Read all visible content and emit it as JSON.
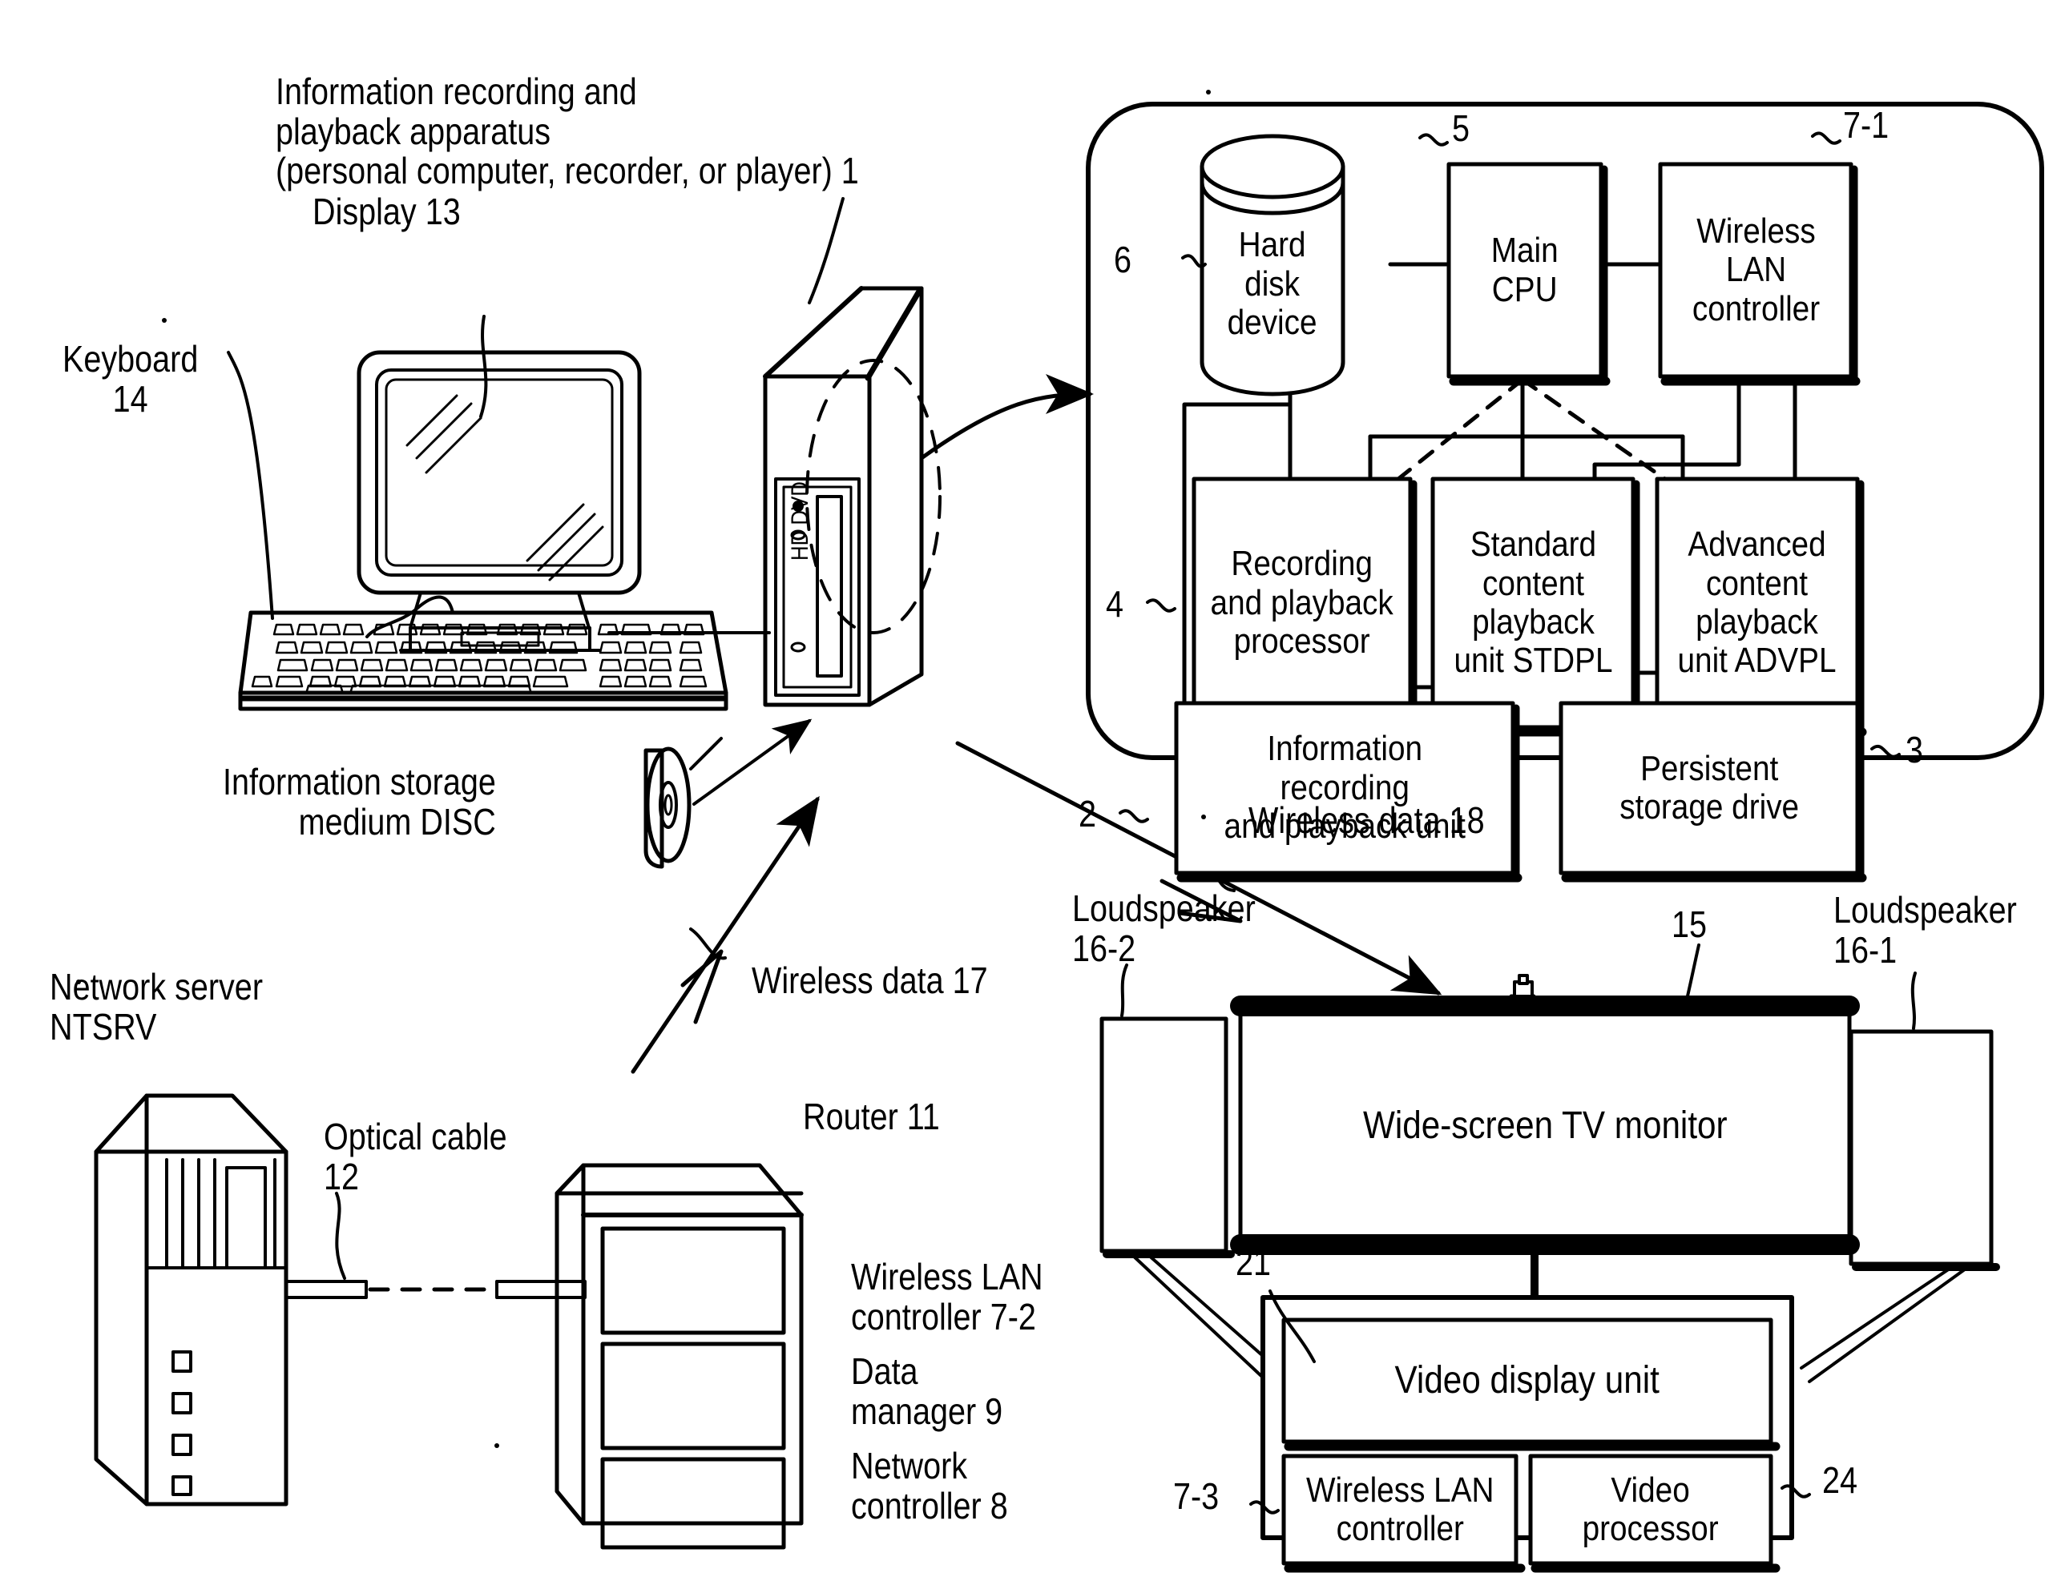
{
  "figure": {
    "title_label": "Information recording and\nplayback apparatus\n(personal computer, recorder, or player) 1",
    "display_label": "Display 13",
    "keyboard_label": "Keyboard\n14",
    "disc_label": "Information storage\nmedium DISC",
    "tower_drive_label": "HD DVD",
    "network_server_label": "Network server\nNTSRV",
    "optical_cable_label": "Optical cable\n12",
    "router_label": "Router 11",
    "wireless_data_17_label": "Wireless data 17",
    "wireless_data_18_label": "Wireless data 18",
    "tv_monitor_label": "Wide-screen TV monitor",
    "tv_monitor_ref": "15",
    "loudspeaker_left_label": "Loudspeaker\n16-2",
    "loudspeaker_right_label": "Loudspeaker\n16-1",
    "video_display_unit_ref": "21",
    "video_processor_ref": "24",
    "wireless_lan_controller_tv_ref": "7-3"
  },
  "router_items": [
    {
      "label": "Wireless LAN\ncontroller 7-2"
    },
    {
      "label": "Data\nmanager 9"
    },
    {
      "label": "Network\ncontroller 8"
    }
  ],
  "apparatus_blocks": {
    "hard_disk_device": {
      "label": "Hard\ndisk\ndevice",
      "ref": "6"
    },
    "main_cpu": {
      "label": "Main\nCPU",
      "ref": "5"
    },
    "wireless_lan_controller": {
      "label": "Wireless\nLAN\ncontroller",
      "ref": "7-1"
    },
    "recording_playback_processor": {
      "label": "Recording\nand playback\nprocessor",
      "ref": "4"
    },
    "standard_content_playback": {
      "label": "Standard\ncontent\nplayback\nunit STDPL",
      "ref": ""
    },
    "advanced_content_playback": {
      "label": "Advanced\ncontent\nplayback\nunit ADVPL",
      "ref": ""
    },
    "information_recording_playback_unit": {
      "label": "Information\nrecording\nand playback unit",
      "ref": "2"
    },
    "persistent_storage_drive": {
      "label": "Persistent\nstorage drive",
      "ref": "3"
    }
  },
  "tv_unit_blocks": {
    "video_display_unit": {
      "label": "Video display unit"
    },
    "wireless_lan_controller": {
      "label": "Wireless LAN\ncontroller"
    },
    "video_processor": {
      "label": "Video\nprocessor"
    }
  },
  "colors": {
    "ink": "#000000",
    "paper": "#ffffff"
  }
}
